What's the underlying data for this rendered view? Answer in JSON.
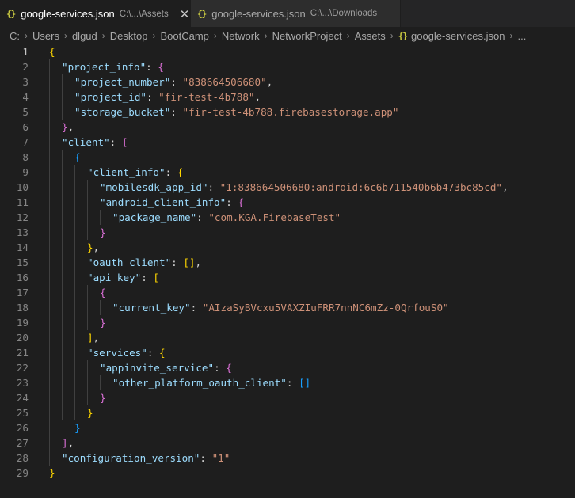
{
  "tabs": [
    {
      "icon": "{}",
      "name": "google-services.json",
      "path": "C:\\...\\Assets",
      "close": "✕"
    },
    {
      "icon": "{}",
      "name": "google-services.json",
      "path": "C:\\...\\Downloads"
    }
  ],
  "breadcrumb": {
    "items": [
      "C:",
      "Users",
      "dlgud",
      "Desktop",
      "BootCamp",
      "Network",
      "NetworkProject",
      "Assets"
    ],
    "file_icon": "{}",
    "file": "google-services.json",
    "more": "..."
  },
  "editor": {
    "active_line": 1,
    "line_numbers": [
      "1",
      "2",
      "3",
      "4",
      "5",
      "6",
      "7",
      "8",
      "9",
      "10",
      "11",
      "12",
      "13",
      "14",
      "15",
      "16",
      "17",
      "18",
      "19",
      "20",
      "21",
      "22",
      "23",
      "24",
      "25",
      "26",
      "27",
      "28",
      "29"
    ],
    "lines": [
      [
        {
          "t": "{",
          "c": "b1"
        }
      ],
      [
        {
          "t": "\"project_info\"",
          "c": "k"
        },
        {
          "t": ": ",
          "c": "p"
        },
        {
          "t": "{",
          "c": "b2"
        }
      ],
      [
        {
          "t": "\"project_number\"",
          "c": "k"
        },
        {
          "t": ": ",
          "c": "p"
        },
        {
          "t": "\"838664506680\"",
          "c": "s"
        },
        {
          "t": ",",
          "c": "p"
        }
      ],
      [
        {
          "t": "\"project_id\"",
          "c": "k"
        },
        {
          "t": ": ",
          "c": "p"
        },
        {
          "t": "\"fir-test-4b788\"",
          "c": "s"
        },
        {
          "t": ",",
          "c": "p"
        }
      ],
      [
        {
          "t": "\"storage_bucket\"",
          "c": "k"
        },
        {
          "t": ": ",
          "c": "p"
        },
        {
          "t": "\"fir-test-4b788.firebasestorage.app\"",
          "c": "s"
        }
      ],
      [
        {
          "t": "}",
          "c": "b2"
        },
        {
          "t": ",",
          "c": "p"
        }
      ],
      [
        {
          "t": "\"client\"",
          "c": "k"
        },
        {
          "t": ": ",
          "c": "p"
        },
        {
          "t": "[",
          "c": "b2"
        }
      ],
      [
        {
          "t": "{",
          "c": "b3"
        }
      ],
      [
        {
          "t": "\"client_info\"",
          "c": "k"
        },
        {
          "t": ": ",
          "c": "p"
        },
        {
          "t": "{",
          "c": "b1"
        }
      ],
      [
        {
          "t": "\"mobilesdk_app_id\"",
          "c": "k"
        },
        {
          "t": ": ",
          "c": "p"
        },
        {
          "t": "\"1:838664506680:android:6c6b711540b6b473bc85cd\"",
          "c": "s"
        },
        {
          "t": ",",
          "c": "p"
        }
      ],
      [
        {
          "t": "\"android_client_info\"",
          "c": "k"
        },
        {
          "t": ": ",
          "c": "p"
        },
        {
          "t": "{",
          "c": "b2"
        }
      ],
      [
        {
          "t": "\"package_name\"",
          "c": "k"
        },
        {
          "t": ": ",
          "c": "p"
        },
        {
          "t": "\"com.KGA.FirebaseTest\"",
          "c": "s"
        }
      ],
      [
        {
          "t": "}",
          "c": "b2"
        }
      ],
      [
        {
          "t": "}",
          "c": "b1"
        },
        {
          "t": ",",
          "c": "p"
        }
      ],
      [
        {
          "t": "\"oauth_client\"",
          "c": "k"
        },
        {
          "t": ": ",
          "c": "p"
        },
        {
          "t": "[]",
          "c": "b1"
        },
        {
          "t": ",",
          "c": "p"
        }
      ],
      [
        {
          "t": "\"api_key\"",
          "c": "k"
        },
        {
          "t": ": ",
          "c": "p"
        },
        {
          "t": "[",
          "c": "b1"
        }
      ],
      [
        {
          "t": "{",
          "c": "b2"
        }
      ],
      [
        {
          "t": "\"current_key\"",
          "c": "k"
        },
        {
          "t": ": ",
          "c": "p"
        },
        {
          "t": "\"AIzaSyBVcxu5VAXZIuFRR7nnNC6mZz-0QrfouS0\"",
          "c": "s"
        }
      ],
      [
        {
          "t": "}",
          "c": "b2"
        }
      ],
      [
        {
          "t": "]",
          "c": "b1"
        },
        {
          "t": ",",
          "c": "p"
        }
      ],
      [
        {
          "t": "\"services\"",
          "c": "k"
        },
        {
          "t": ": ",
          "c": "p"
        },
        {
          "t": "{",
          "c": "b1"
        }
      ],
      [
        {
          "t": "\"appinvite_service\"",
          "c": "k"
        },
        {
          "t": ": ",
          "c": "p"
        },
        {
          "t": "{",
          "c": "b2"
        }
      ],
      [
        {
          "t": "\"other_platform_oauth_client\"",
          "c": "k"
        },
        {
          "t": ": ",
          "c": "p"
        },
        {
          "t": "[]",
          "c": "b3"
        }
      ],
      [
        {
          "t": "}",
          "c": "b2"
        }
      ],
      [
        {
          "t": "}",
          "c": "b1"
        }
      ],
      [
        {
          "t": "}",
          "c": "b3"
        }
      ],
      [
        {
          "t": "]",
          "c": "b2"
        },
        {
          "t": ",",
          "c": "p"
        }
      ],
      [
        {
          "t": "\"configuration_version\"",
          "c": "k"
        },
        {
          "t": ": ",
          "c": "p"
        },
        {
          "t": "\"1\"",
          "c": "s"
        }
      ],
      [
        {
          "t": "}",
          "c": "b1"
        }
      ]
    ]
  },
  "colors": {
    "key": "#9cdcfe",
    "string": "#ce9178",
    "punct": "#d4d4d4",
    "bracket1": "#ffd700",
    "bracket2": "#da70d6",
    "bracket3": "#179fff",
    "json_icon": "#cbcb41",
    "background": "#1e1e1e"
  }
}
